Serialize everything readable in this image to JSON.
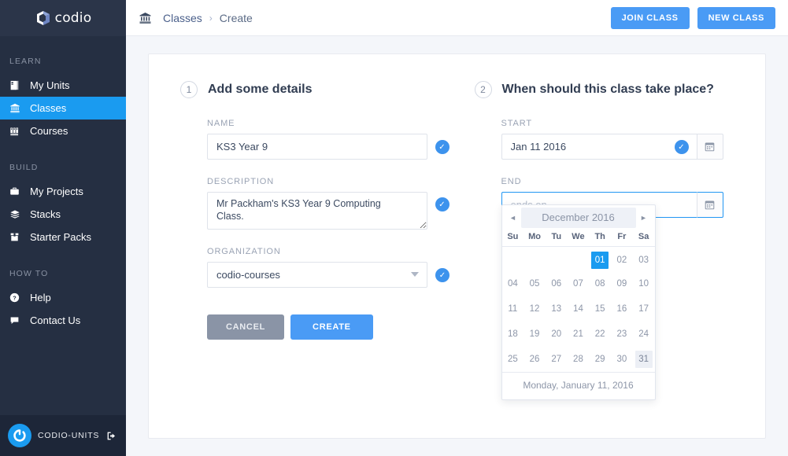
{
  "brand": {
    "name": "codio",
    "logo_icon": "codio-cube-logo"
  },
  "colors": {
    "sidebar_bg": "#252f42",
    "sidebar_logo_bg": "#2b3549",
    "sidebar_footer_bg": "#1d2638",
    "accent_blue": "#1a9bf0",
    "button_blue": "#4a9bf5",
    "cancel_grey": "#8a94a6",
    "page_bg": "#f4f6fa",
    "check_badge": "#3d93ed"
  },
  "sidebar": {
    "sections": [
      {
        "title": "LEARN",
        "items": [
          {
            "label": "My Units",
            "icon": "book-icon",
            "active": false
          },
          {
            "label": "Classes",
            "icon": "bank-icon",
            "active": true
          },
          {
            "label": "Courses",
            "icon": "books-icon",
            "active": false
          }
        ]
      },
      {
        "title": "BUILD",
        "items": [
          {
            "label": "My Projects",
            "icon": "briefcase-icon",
            "active": false
          },
          {
            "label": "Stacks",
            "icon": "layers-icon",
            "active": false
          },
          {
            "label": "Starter Packs",
            "icon": "package-icon",
            "active": false
          }
        ]
      },
      {
        "title": "HOW TO",
        "items": [
          {
            "label": "Help",
            "icon": "question-circle-icon",
            "active": false
          },
          {
            "label": "Contact Us",
            "icon": "chat-bubble-icon",
            "active": false
          }
        ]
      }
    ],
    "footer": {
      "user": "CODIO-UNITS",
      "avatar_icon": "power-avatar-icon",
      "logout_icon": "logout-icon"
    }
  },
  "topbar": {
    "section_icon": "bank-icon",
    "breadcrumb": {
      "parent": "Classes",
      "separator": "›",
      "current": "Create"
    },
    "join_class_label": "JOIN CLASS",
    "new_class_label": "NEW CLASS"
  },
  "form": {
    "step1": {
      "number": "1",
      "title": "Add some details",
      "name": {
        "label": "NAME",
        "value": "KS3 Year 9",
        "valid": true
      },
      "description": {
        "label": "DESCRIPTION",
        "value": "Mr Packham's KS3 Year 9 Computing Class.",
        "valid": true
      },
      "organization": {
        "label": "ORGANIZATION",
        "value": "codio-courses",
        "valid": true,
        "caret_icon": "chevron-down-icon"
      }
    },
    "step2": {
      "number": "2",
      "title": "When should this class take place?",
      "start": {
        "label": "START",
        "value": "Jan 11 2016",
        "valid": true,
        "calendar_icon": "calendar-icon"
      },
      "end": {
        "label": "END",
        "value": "",
        "placeholder": "ends on...",
        "calendar_icon": "calendar-icon",
        "focused": true
      }
    },
    "actions": {
      "cancel_label": "CANCEL",
      "create_label": "CREATE"
    }
  },
  "datepicker": {
    "prev_icon": "triangle-left-icon",
    "next_icon": "triangle-right-icon",
    "month_label": "December 2016",
    "weekdays": [
      "Su",
      "Mo",
      "Tu",
      "We",
      "Th",
      "Fr",
      "Sa"
    ],
    "weeks": [
      [
        {
          "day": "",
          "state": "empty"
        },
        {
          "day": "",
          "state": "empty"
        },
        {
          "day": "",
          "state": "empty"
        },
        {
          "day": "",
          "state": "empty"
        },
        {
          "day": "01",
          "state": "selected"
        },
        {
          "day": "02",
          "state": "normal"
        },
        {
          "day": "03",
          "state": "normal"
        }
      ],
      [
        {
          "day": "04",
          "state": "normal"
        },
        {
          "day": "05",
          "state": "normal"
        },
        {
          "day": "06",
          "state": "normal"
        },
        {
          "day": "07",
          "state": "normal"
        },
        {
          "day": "08",
          "state": "normal"
        },
        {
          "day": "09",
          "state": "normal"
        },
        {
          "day": "10",
          "state": "normal"
        }
      ],
      [
        {
          "day": "11",
          "state": "normal"
        },
        {
          "day": "12",
          "state": "normal"
        },
        {
          "day": "13",
          "state": "normal"
        },
        {
          "day": "14",
          "state": "normal"
        },
        {
          "day": "15",
          "state": "normal"
        },
        {
          "day": "16",
          "state": "normal"
        },
        {
          "day": "17",
          "state": "normal"
        }
      ],
      [
        {
          "day": "18",
          "state": "normal"
        },
        {
          "day": "19",
          "state": "normal"
        },
        {
          "day": "20",
          "state": "normal"
        },
        {
          "day": "21",
          "state": "normal"
        },
        {
          "day": "22",
          "state": "normal"
        },
        {
          "day": "23",
          "state": "normal"
        },
        {
          "day": "24",
          "state": "normal"
        }
      ],
      [
        {
          "day": "25",
          "state": "normal"
        },
        {
          "day": "26",
          "state": "normal"
        },
        {
          "day": "27",
          "state": "normal"
        },
        {
          "day": "28",
          "state": "normal"
        },
        {
          "day": "29",
          "state": "normal"
        },
        {
          "day": "30",
          "state": "normal"
        },
        {
          "day": "31",
          "state": "hovered"
        }
      ]
    ],
    "footer_date": "Monday, January 11, 2016"
  }
}
